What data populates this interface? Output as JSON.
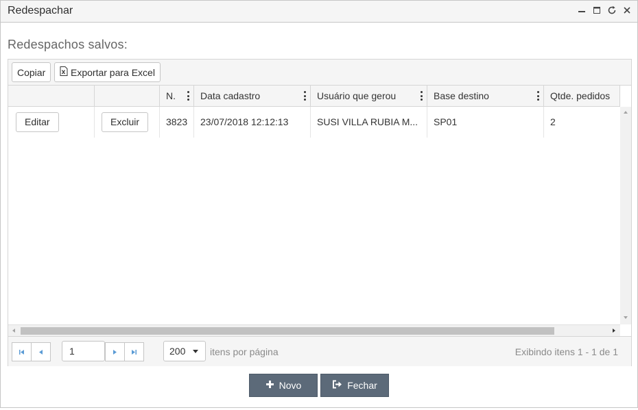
{
  "window": {
    "title": "Redespachar"
  },
  "section_label": "Redespachos salvos:",
  "toolbar": {
    "copy_label": "Copiar",
    "export_label": "Exportar para Excel"
  },
  "columns": [
    {
      "label": ""
    },
    {
      "label": ""
    },
    {
      "label": "N."
    },
    {
      "label": "Data cadastro"
    },
    {
      "label": "Usuário que gerou"
    },
    {
      "label": "Base destino"
    },
    {
      "label": "Qtde. pedidos"
    }
  ],
  "rows": [
    {
      "edit_label": "Editar",
      "delete_label": "Excluir",
      "numero": "3823",
      "data_cadastro": "23/07/2018 12:12:13",
      "usuario": "SUSI VILLA RUBIA M...",
      "base_destino": "SP01",
      "qtde_pedidos": "2"
    }
  ],
  "pager": {
    "page_value": "1",
    "page_size": "200",
    "per_page_label": "itens por página",
    "info": "Exibindo itens 1 - 1 de 1"
  },
  "footer": {
    "new_label": "Novo",
    "close_label": "Fechar"
  },
  "colors": {
    "footer_button_bg": "#5c6a79",
    "toolbar_bg": "#f5f5f5"
  },
  "icons": [
    "minimize-icon",
    "maximize-icon",
    "refresh-icon",
    "close-icon",
    "excel-file-icon",
    "plus-icon",
    "exit-icon"
  ]
}
